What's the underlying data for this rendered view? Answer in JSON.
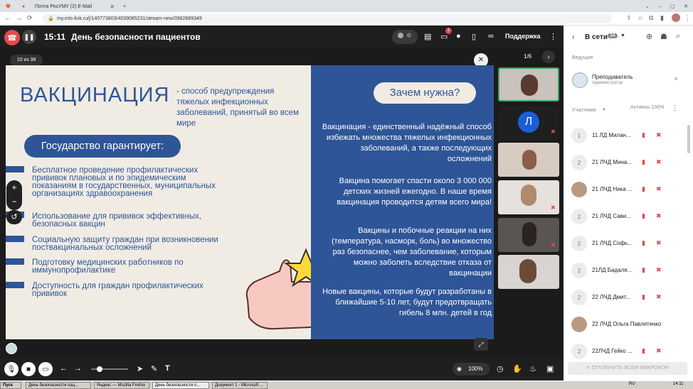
{
  "browser": {
    "tabs": [
      "Почта РосУМУ (2) E-Mail",
      "День безопасности пациентов"
    ],
    "url": "my.mts-link.ru/j/140773803/4039085231/stream-new/3982889349"
  },
  "topbar": {
    "time": "15:11",
    "title": "День безопасности пациентов",
    "notif_count": "1",
    "support": "Поддержка"
  },
  "slide": {
    "counter": "10 из 38",
    "pages": "1/6",
    "title": "ВАКЦИНАЦИЯ",
    "subtitle": "- способ предупреждения тяжелых инфекционных заболеваний, принятый во всем мире",
    "guarantee_pill": "Государство гарантирует:",
    "items": [
      "Бесплатное проведение профилактических прививок плановых и по эпидемическим показаниям в государственных, муниципальных организациях здравоохранения",
      "Использование для прививок эффективных, безопасных вакцин",
      "Социальную защиту граждан при возникновении поствакцинальных осложнений",
      "Подготовку медицинских работников по иммунопрофилактике",
      "Доступность для граждан профилактических прививок"
    ],
    "why_pill": "Зачем нужна?",
    "right_paras": [
      "Вакцинация - единственный надёжный способ избежать множества тяжелых инфекционных заболеваний, а также последующих осложнений",
      "Вакцина помогает спасти около 3 000 000 детских жизней ежегодно. В наше время вакцинация проводится детям всего мира!",
      "Вакцины и побочные реакции на них (температура, насморк, боль) во множество раз безопаснее, чем заболевание, которым можно заболеть вследствие отказа от вакцинации",
      "Новые вакцины, которые будут разработаны в ближайшие 5-10 лет, будут предотвращать гибель 8 млн. детей в год"
    ]
  },
  "thumbs": {
    "letter": "Л"
  },
  "panel": {
    "online_label": "В сети",
    "online_count": "34",
    "hosts_label": "Ведущие",
    "host_name": "Преподаватель",
    "host_role": "Администратор",
    "host_mark": "я",
    "participants_label": "Участники",
    "active_label": "Активны 100%",
    "participants": [
      {
        "avatar": "1",
        "name": "11 ЛД Милан..."
      },
      {
        "avatar": "2",
        "name": "21 ЛЧД Мина..."
      },
      {
        "avatar": "",
        "name": "21 ЛЧД Ника ..."
      },
      {
        "avatar": "2",
        "name": "21 ЛЧД Сави..."
      },
      {
        "avatar": "2",
        "name": "21 ЛЧД Софь..."
      },
      {
        "avatar": "2",
        "name": "21ЛД Бадаля..."
      },
      {
        "avatar": "2",
        "name": "22 ЛЧД Дмит..."
      },
      {
        "avatar": "",
        "name": "22 ЛЧД Ольга Павлятенко"
      },
      {
        "avatar": "2",
        "name": "22ЛЧД Гейко ..."
      }
    ],
    "mute_all": "ОТКЛЮЧИТЬ ВСЕМ МИКРОФОН"
  },
  "bottombar": {
    "viewers": "100%"
  },
  "taskbar": {
    "start": "Пуск",
    "items": [
      "День безопасности пац...",
      "Яндекс — Mozilla Firefox",
      "День безопасности п...",
      "Документ 1 - Microsoft ..."
    ],
    "lang": "RU",
    "clock": "14:11"
  },
  "colors": {
    "accent": "#2e5597",
    "danger": "#e5484d"
  }
}
